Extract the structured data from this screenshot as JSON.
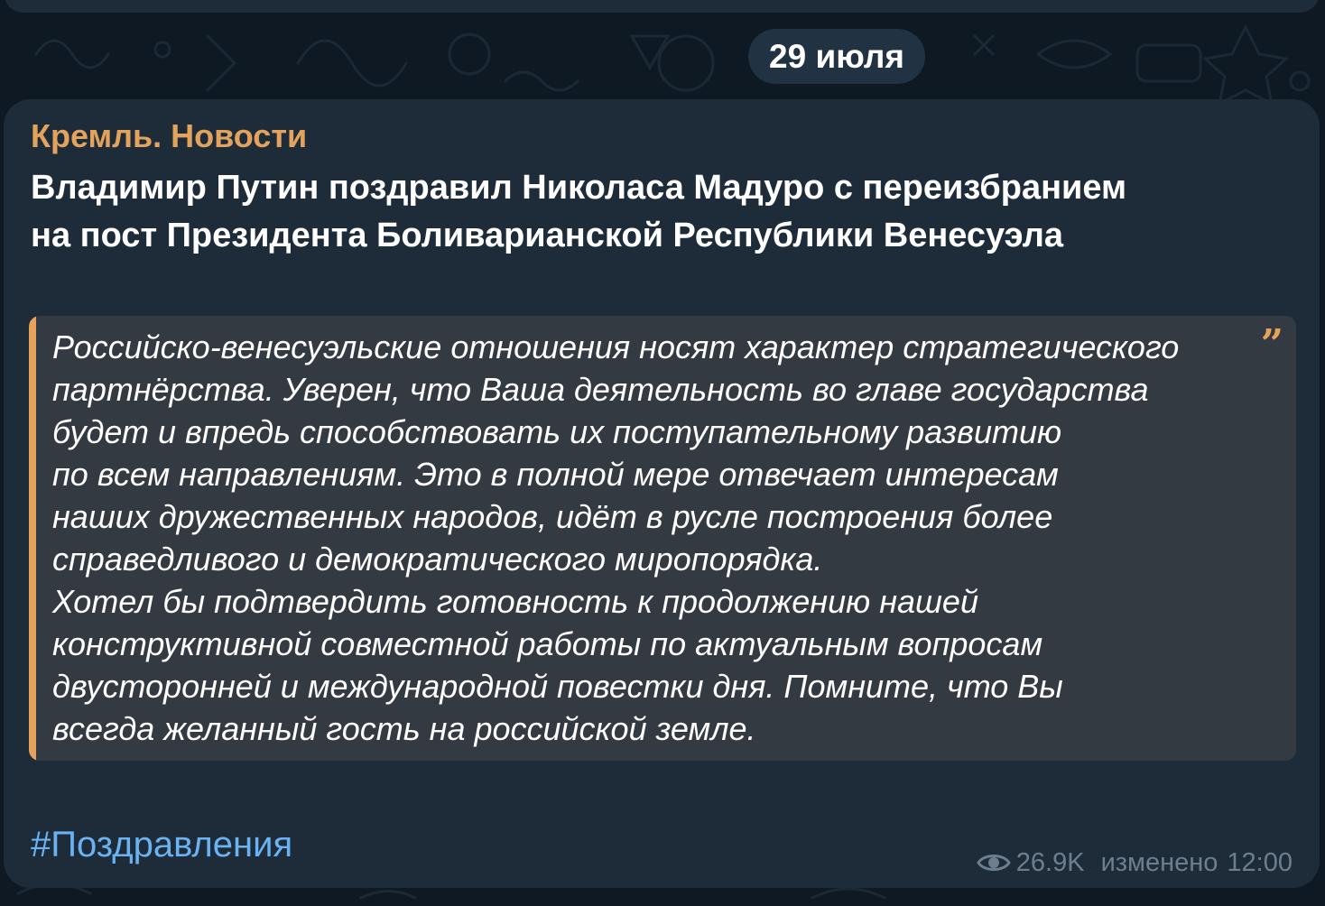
{
  "date_separator": "29 июля",
  "message": {
    "channel_name": "Кремль. Новости",
    "headline_lines": [
      "Владимир Путин поздравил Николаса Мадуро с переизбранием",
      "на пост Президента Боливарианской Республики Венесуэла"
    ],
    "quote": {
      "lines": [
        "Российско-венесуэльские отношения носят характер стратегического",
        "партнёрства. Уверен, что Ваша деятельность во главе государства",
        "будет и впредь способствовать их поступательному развитию",
        "по всем направлениям. Это в полной мере отвечает интересам",
        "наших дружественных народов, идёт в русле построения более",
        "справедливого и демократического миропорядка.",
        "Хотел бы подтвердить готовность к продолжению нашей",
        "конструктивной совместной работы по актуальным вопросам",
        "двусторонней и международной повестки дня. Помните, что Вы",
        "всегда желанный гость на российской земле."
      ],
      "icon": "quote-mark-icon"
    },
    "hashtag": "#Поздравления",
    "views": "26.9K",
    "edited_label": "изменено",
    "time": "12:00",
    "views_icon": "eye-icon"
  },
  "colors": {
    "background": "#0f1923",
    "bubble": "#1e2c3a",
    "channel_name": "#e3a35d",
    "quote_bg": "#343a41",
    "quote_bar": "#e3a35d",
    "hashtag": "#6ab3f3",
    "meta": "#6d7f8f"
  }
}
